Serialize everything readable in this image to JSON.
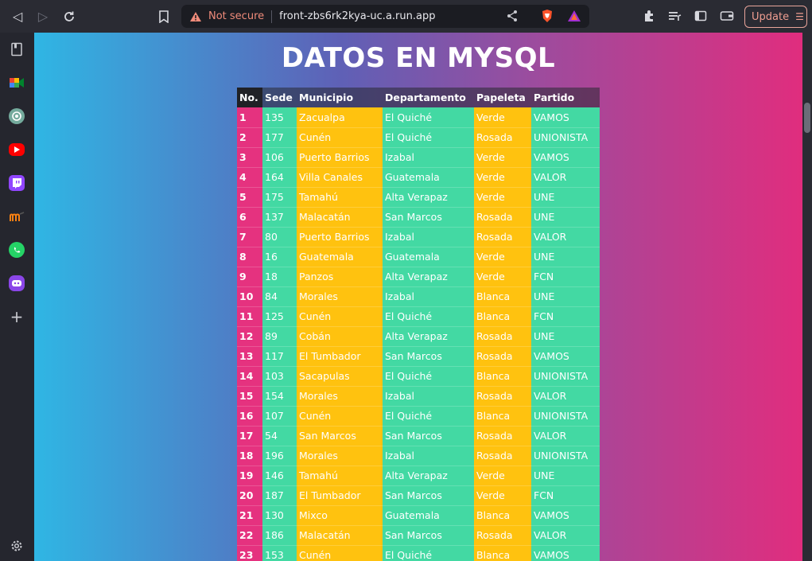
{
  "browser": {
    "not_secure_label": "Not secure",
    "url": "front-zbs6rk2kya-uc.a.run.app",
    "update_label": "Update",
    "update_menu_glyph": "☰"
  },
  "page": {
    "title": "DATOS EN MYSQL"
  },
  "table": {
    "headers": {
      "no": "No.",
      "sede": "Sede",
      "municipio": "Municipio",
      "departamento": "Departamento",
      "papeleta": "Papeleta",
      "partido": "Partido"
    },
    "rows": [
      {
        "no": "1",
        "sede": "135",
        "municipio": "Zacualpa",
        "departamento": "El Quiché",
        "papeleta": "Verde",
        "partido": "VAMOS"
      },
      {
        "no": "2",
        "sede": "177",
        "municipio": "Cunén",
        "departamento": "El Quiché",
        "papeleta": "Rosada",
        "partido": "UNIONISTA"
      },
      {
        "no": "3",
        "sede": "106",
        "municipio": "Puerto Barrios",
        "departamento": "Izabal",
        "papeleta": "Verde",
        "partido": "VAMOS"
      },
      {
        "no": "4",
        "sede": "164",
        "municipio": "Villa Canales",
        "departamento": "Guatemala",
        "papeleta": "Verde",
        "partido": "VALOR"
      },
      {
        "no": "5",
        "sede": "175",
        "municipio": "Tamahú",
        "departamento": "Alta Verapaz",
        "papeleta": "Verde",
        "partido": "UNE"
      },
      {
        "no": "6",
        "sede": "137",
        "municipio": "Malacatán",
        "departamento": "San Marcos",
        "papeleta": "Rosada",
        "partido": "UNE"
      },
      {
        "no": "7",
        "sede": "80",
        "municipio": "Puerto Barrios",
        "departamento": "Izabal",
        "papeleta": "Rosada",
        "partido": "VALOR"
      },
      {
        "no": "8",
        "sede": "16",
        "municipio": "Guatemala",
        "departamento": "Guatemala",
        "papeleta": "Verde",
        "partido": "UNE"
      },
      {
        "no": "9",
        "sede": "18",
        "municipio": "Panzos",
        "departamento": "Alta Verapaz",
        "papeleta": "Verde",
        "partido": "FCN"
      },
      {
        "no": "10",
        "sede": "84",
        "municipio": "Morales",
        "departamento": "Izabal",
        "papeleta": "Blanca",
        "partido": "UNE"
      },
      {
        "no": "11",
        "sede": "125",
        "municipio": "Cunén",
        "departamento": "El Quiché",
        "papeleta": "Blanca",
        "partido": "FCN"
      },
      {
        "no": "12",
        "sede": "89",
        "municipio": "Cobán",
        "departamento": "Alta Verapaz",
        "papeleta": "Rosada",
        "partido": "UNE"
      },
      {
        "no": "13",
        "sede": "117",
        "municipio": "El Tumbador",
        "departamento": "San Marcos",
        "papeleta": "Rosada",
        "partido": "VAMOS"
      },
      {
        "no": "14",
        "sede": "103",
        "municipio": "Sacapulas",
        "departamento": "El Quiché",
        "papeleta": "Blanca",
        "partido": "UNIONISTA"
      },
      {
        "no": "15",
        "sede": "154",
        "municipio": "Morales",
        "departamento": "Izabal",
        "papeleta": "Rosada",
        "partido": "VALOR"
      },
      {
        "no": "16",
        "sede": "107",
        "municipio": "Cunén",
        "departamento": "El Quiché",
        "papeleta": "Blanca",
        "partido": "UNIONISTA"
      },
      {
        "no": "17",
        "sede": "54",
        "municipio": "San Marcos",
        "departamento": "San Marcos",
        "papeleta": "Rosada",
        "partido": "VALOR"
      },
      {
        "no": "18",
        "sede": "196",
        "municipio": "Morales",
        "departamento": "Izabal",
        "papeleta": "Rosada",
        "partido": "UNIONISTA"
      },
      {
        "no": "19",
        "sede": "146",
        "municipio": "Tamahú",
        "departamento": "Alta Verapaz",
        "papeleta": "Verde",
        "partido": "UNE"
      },
      {
        "no": "20",
        "sede": "187",
        "municipio": "El Tumbador",
        "departamento": "San Marcos",
        "papeleta": "Verde",
        "partido": "FCN"
      },
      {
        "no": "21",
        "sede": "130",
        "municipio": "Mixco",
        "departamento": "Guatemala",
        "papeleta": "Blanca",
        "partido": "VAMOS"
      },
      {
        "no": "22",
        "sede": "186",
        "municipio": "Malacatán",
        "departamento": "San Marcos",
        "papeleta": "Rosada",
        "partido": "VALOR"
      },
      {
        "no": "23",
        "sede": "153",
        "municipio": "Cunén",
        "departamento": "El Quiché",
        "papeleta": "Blanca",
        "partido": "VAMOS"
      }
    ]
  },
  "colors": {
    "col_no": "#e5327f",
    "col_green": "#43d9a3",
    "col_yellow": "#ffc20f",
    "warning": "#f08b7a"
  },
  "icons": {
    "topbar": [
      "back-icon",
      "forward-icon",
      "reload-icon",
      "bookmark-icon",
      "warning-icon",
      "share-icon",
      "brave-shield-icon",
      "brave-rewards-icon",
      "extensions-icon",
      "playlist-icon",
      "sidebar-icon",
      "wallet-icon",
      "menu-icon"
    ],
    "sidebar": [
      "reading-list-icon",
      "google-meet-icon",
      "chatgpt-icon",
      "youtube-icon",
      "twitch-icon",
      "moodle-icon",
      "whatsapp-icon",
      "leo-ai-icon",
      "add-icon",
      "settings-icon"
    ]
  }
}
